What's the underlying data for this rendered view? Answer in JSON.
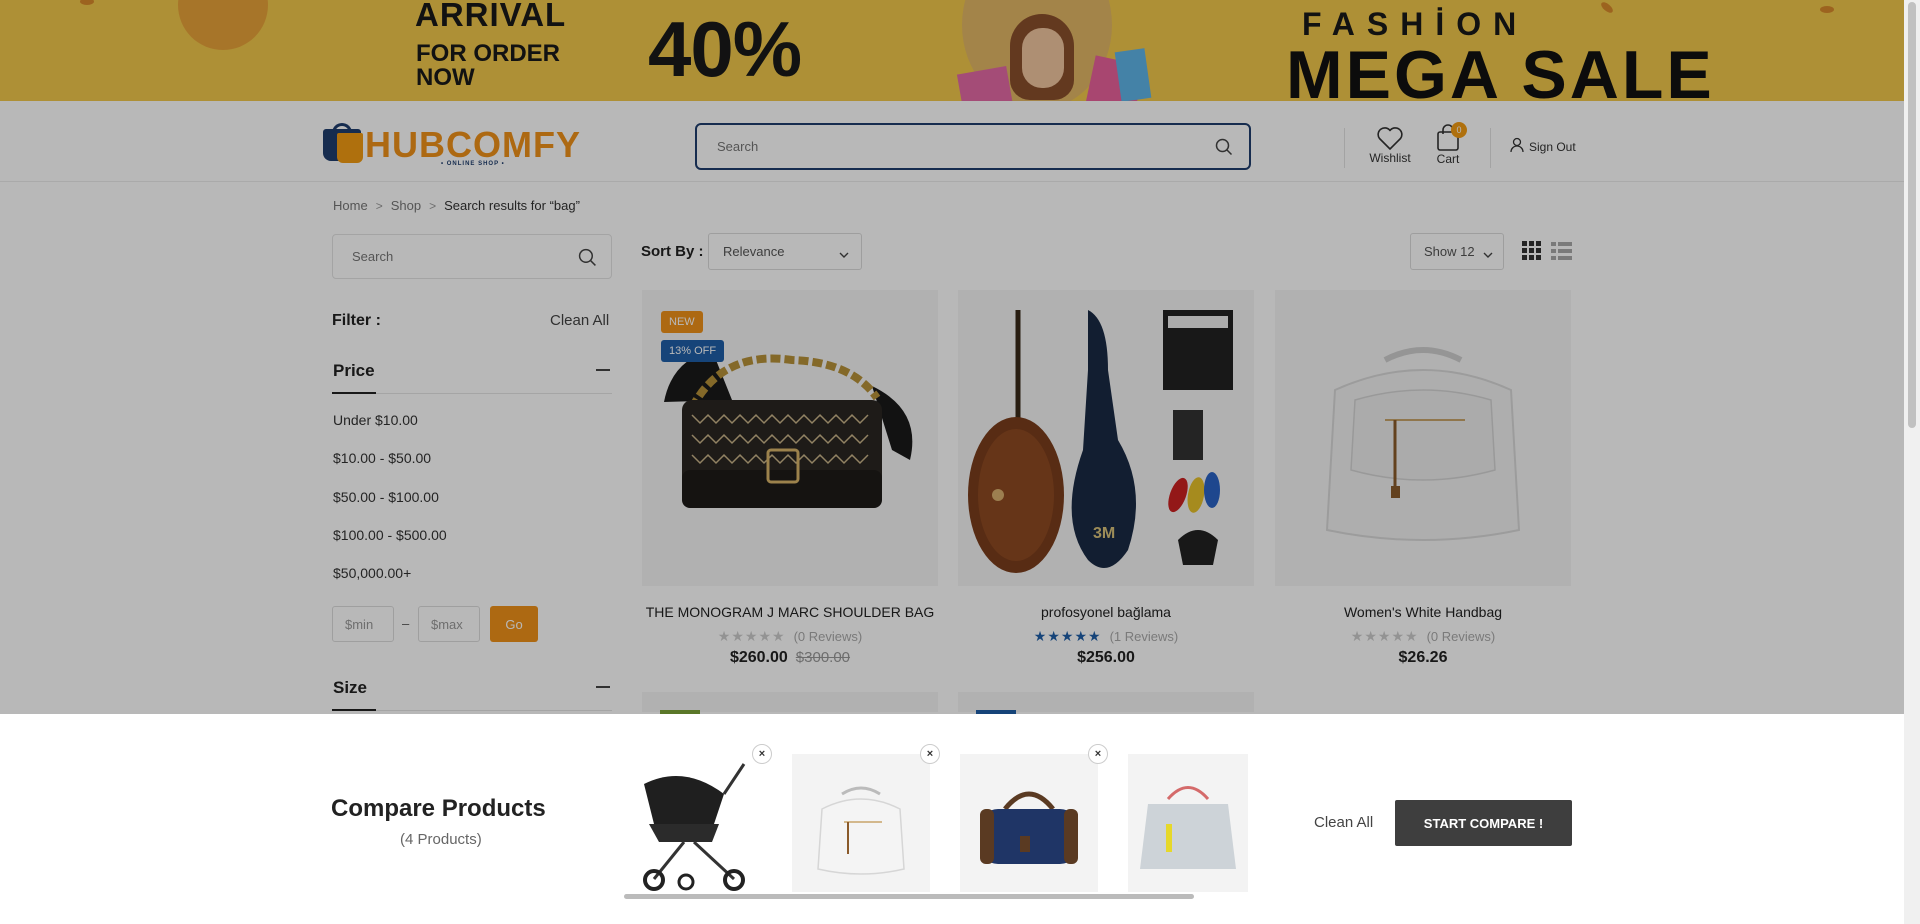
{
  "banner": {
    "arrival": "ARRIVAL",
    "for_order": "FOR ORDER NOW",
    "percent": "40%",
    "fashion": "FASHİON",
    "mega_sale": "MEGA SALE"
  },
  "header": {
    "logo_text": "HUBCOMFY",
    "logo_sub": "• ONLINE SHOP •",
    "search_placeholder": "Search",
    "wishlist_label": "Wishlist",
    "cart_label": "Cart",
    "cart_count": "0",
    "signout_label": "Sign Out"
  },
  "breadcrumb": {
    "items": [
      "Home",
      "Shop",
      "Search results for “bag”"
    ]
  },
  "sidebar": {
    "search_placeholder": "Search",
    "filter_label": "Filter :",
    "clean_all": "Clean All",
    "price_title": "Price",
    "price_ranges": [
      "Under $10.00",
      "$10.00 - $50.00",
      "$50.00 - $100.00",
      "$100.00 - $500.00",
      "$50,000.00+"
    ],
    "min_placeholder": "$min",
    "max_placeholder": "$max",
    "dash": "–",
    "go_label": "Go",
    "size_title": "Size"
  },
  "toolbar": {
    "sort_label": "Sort By :",
    "sort_value": "Relevance",
    "show_value": "Show 12"
  },
  "products": [
    {
      "name": "THE MONOGRAM J MARC SHOULDER BAG",
      "badges": [
        "NEW",
        "13% OFF"
      ],
      "stars": "★★★★★",
      "reviews": "(0 Reviews)",
      "rating": 0,
      "price": "$260.00",
      "old_price": "$300.00"
    },
    {
      "name": "profosyonel bağlama",
      "stars": "★★★★★",
      "reviews": "(1 Reviews)",
      "rating": 5,
      "price": "$256.00"
    },
    {
      "name": "Women's White Handbag",
      "stars": "★★★★★",
      "reviews": "(0 Reviews)",
      "rating": 0,
      "price": "$26.26"
    }
  ],
  "compare": {
    "title": "Compare Products",
    "count": "(4 Products)",
    "clean_all": "Clean All",
    "start_label": "START COMPARE !",
    "close_glyph": "×"
  },
  "colors": {
    "accent": "#f0921a",
    "brand_navy": "#1f3e6e",
    "badge_new": "#f0921a",
    "badge_off": "#1f5fa8",
    "star_filled": "#1f5fa8",
    "star_empty": "#cccccc",
    "start_button": "#3e3e3e"
  }
}
